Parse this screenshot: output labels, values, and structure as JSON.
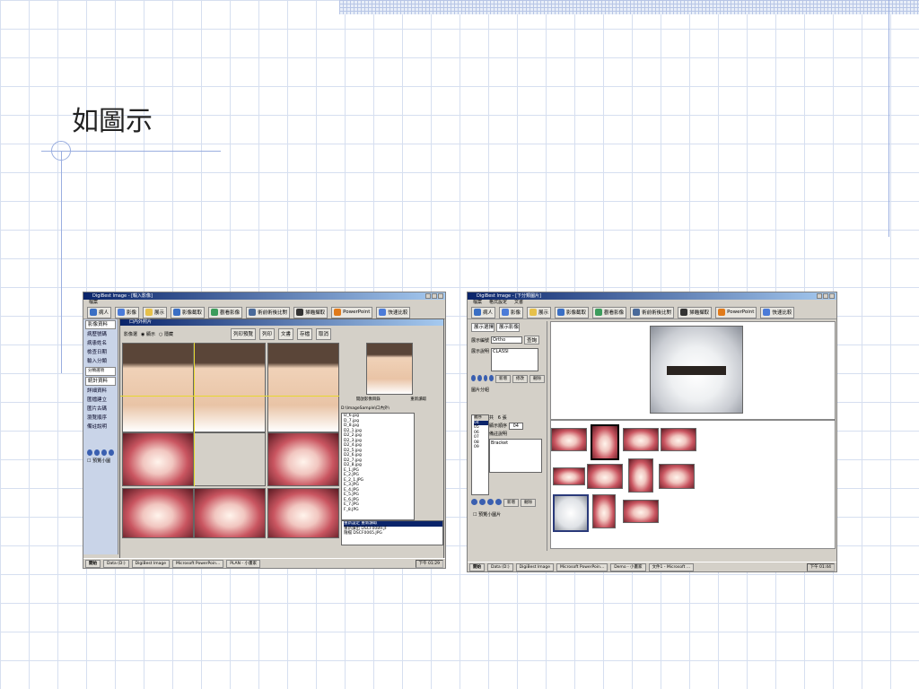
{
  "slide": {
    "title": "如圖示"
  },
  "window_left": {
    "title": "DigiBest Image - [輸入影像]",
    "menu": [
      "檔案"
    ],
    "toolbar": [
      "病人",
      "影像",
      "展示",
      "影像截取",
      "觀看影像",
      "術前術後比對",
      "掃瞄擷取",
      "PowerPoint",
      "快速比較"
    ],
    "subwindow_title": "口內外照片",
    "subtoolbar": [
      "列印預覽",
      "列印",
      "文書",
      "存檔",
      "取消"
    ],
    "options": [
      "影像選",
      "顯示",
      "隱藏"
    ],
    "sidebar": {
      "tab1": "影像資料",
      "fields": [
        "病歷號碼",
        "病患姓名",
        "檢查日期",
        "輸入分類"
      ],
      "tab2": "分類選項",
      "tab3": "統計資料",
      "items": [
        "詳細資料",
        "匯檔建立",
        "匯片古碼",
        "瀏覽順序",
        "備註說明"
      ],
      "checkbox": "預覽小圖"
    },
    "file_panel": {
      "header": [
        "開啟影像目錄",
        "重新讀取"
      ],
      "path": "D:\\ImageSample\\口內外\\",
      "files": [
        "D_6.jpg",
        "D_7.jpg",
        "D_8.jpg",
        "D2_1.jpg",
        "D2_2.jpg",
        "D2_3.jpg",
        "D2_4.jpg",
        "D2_5.jpg",
        "D2_6.jpg",
        "D2_7.jpg",
        "D2_8.jpg",
        "E_1.JPG",
        "E_2.JPG",
        "E_2_1.JPG",
        "E_3.JPG",
        "E_4.JPG",
        "E_5.JPG",
        "E_6.JPG",
        "E_7.JPG",
        "F_8.JPG"
      ],
      "selected": "重新設定 重新讀取",
      "status": [
        "重新讀出 DSCF0089.JF",
        "隨檔 DSCF0065.JPG"
      ]
    },
    "taskbar": [
      "開始",
      "Data (D:)",
      "DigiBest Image",
      "Microsoft PowerPoin...",
      "PLAN - 小畫家"
    ],
    "clock": "下午 01:29"
  },
  "window_right": {
    "title": "DigiBest Image - [下分類圖片]",
    "menu": [
      "檔案",
      "格式設定",
      "文書"
    ],
    "toolbar": [
      "病人",
      "影像",
      "展示",
      "影像截取",
      "觀看影像",
      "術前術後比對",
      "掃瞄擷取",
      "PowerPoint",
      "快速比較"
    ],
    "sidebar": {
      "tabs": [
        "展示選擇",
        "展示影像"
      ],
      "label_code": "展示編號",
      "code_value": "Ortho",
      "query": "查詢",
      "label_desc": "展示說明",
      "desc_value": "CLASSI",
      "buttons": [
        "新增",
        "修改",
        "刪除"
      ],
      "group": "圖片分組",
      "order_head": "順序",
      "orders": [
        "04",
        "05",
        "06",
        "07",
        "08",
        "09"
      ],
      "total_label": "共",
      "total_count": "6",
      "total_unit": "張",
      "show_order_label": "顯示順序",
      "show_order_value": "04",
      "note_label": "備註說明",
      "note_value": "Bracket",
      "buttons2": [
        "新增",
        "刪除"
      ],
      "checkbox": "預覽小圖片"
    },
    "taskbar": [
      "開始",
      "Data (D:)",
      "DigiBest Image",
      "Microsoft PowerPoin...",
      "Demo - 小畫家",
      "文件1 - Microsoft ..."
    ],
    "clock": "下午 01:44"
  },
  "colors": {
    "titlebar_start": "#0a246a",
    "titlebar_end": "#a6caf0",
    "window_bg": "#d4d0c8",
    "sidebar_bg": "#c9d4e8",
    "grid_line": "#d6dff0"
  }
}
